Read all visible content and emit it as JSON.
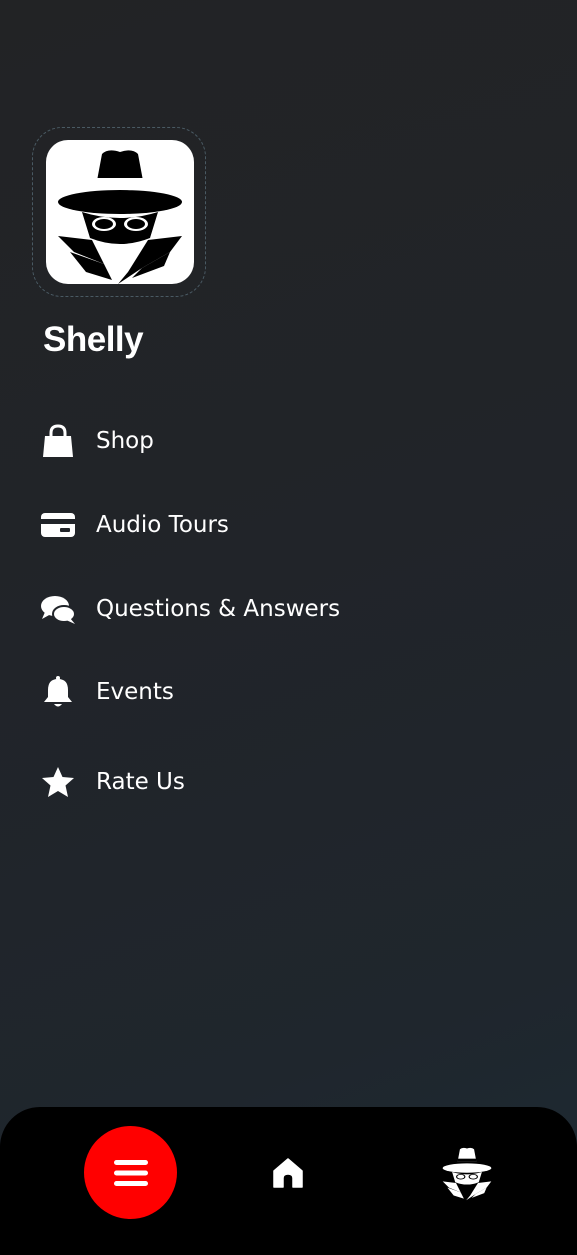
{
  "profile": {
    "name": "Shelly",
    "avatar_icon": "spy-icon"
  },
  "menu": {
    "items": [
      {
        "label": "Shop",
        "icon": "shopping-bag-icon"
      },
      {
        "label": "Audio Tours",
        "icon": "credit-card-icon"
      },
      {
        "label": "Questions & Answers",
        "icon": "chat-bubbles-icon"
      },
      {
        "label": "Events",
        "icon": "bell-icon"
      },
      {
        "label": "Rate Us",
        "icon": "star-icon"
      }
    ]
  },
  "bottom_nav": {
    "items": [
      {
        "icon": "hamburger-menu-icon",
        "active": true
      },
      {
        "icon": "home-icon",
        "active": false
      },
      {
        "icon": "spy-icon",
        "active": false
      }
    ]
  },
  "colors": {
    "background": "#212429",
    "accent": "#ff0000",
    "bottom_bar": "#000000",
    "text": "#ffffff"
  }
}
